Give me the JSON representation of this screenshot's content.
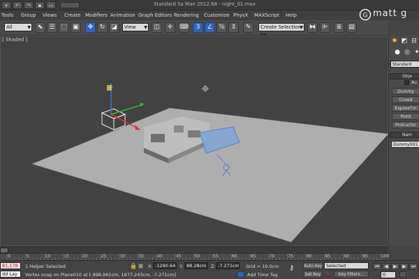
{
  "window": {
    "title": "Standard Sa Man 2012.68 - night_01.max",
    "quick_access": [
      "↶",
      "↷",
      "▾"
    ]
  },
  "menu": [
    "Tools",
    "Group",
    "Views",
    "Create",
    "Modifiers",
    "Animation",
    "Graph Editors",
    "Rendering",
    "Customize",
    "PhysX",
    "MAXScript",
    "Help"
  ],
  "toolbar": {
    "selection_filter": "All",
    "ref_coord": "View",
    "named_selection": "Create Selection Se"
  },
  "viewport": {
    "label": "[ Shaded ]"
  },
  "command_panel": {
    "category": "Standard",
    "object_type_header": "Obje",
    "auto_grid": "Au",
    "buttons": [
      "Dummy",
      "Crowd",
      "ExposeTm",
      "Point",
      "Protractor"
    ],
    "name_header": "Nam",
    "object_name": "Dummy001"
  },
  "logo": {
    "text": "matt g"
  },
  "timeline": {
    "ticks": [
      "0",
      "5",
      "10",
      "15",
      "20",
      "25",
      "30",
      "35",
      "40",
      "45",
      "50",
      "55",
      "60",
      "65",
      "70",
      "75",
      "80",
      "85",
      "90",
      "95",
      "100"
    ]
  },
  "status": {
    "mini_listener_1": "81,178",
    "mini_listener_2": "dd Lay",
    "selection_info": "1 Helper Selected",
    "prompt": "Vertex snap on Plane010 at [-998.961cm, 1877.243cm, -7.271cm]",
    "x_label": "X:",
    "x_value": "-1290.641c",
    "y_label": "Y:",
    "y_value": "88.28cm",
    "z_label": "Z:",
    "z_value": "-7.271cm",
    "grid": "Grid = 10.0cm",
    "add_time_tag": "Add Time Tag",
    "auto_key": "Auto Key",
    "set_key": "Set Key",
    "selected": "Selected",
    "key_filters": "Key Filters...",
    "frame": "0"
  }
}
